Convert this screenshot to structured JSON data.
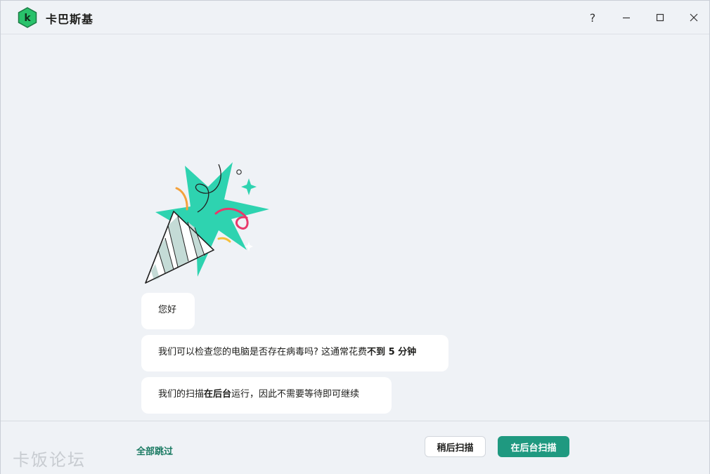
{
  "window": {
    "title": "卡巴斯基",
    "help_glyph": "?",
    "minimize_glyph": "—",
    "maximize_glyph": "☐",
    "close_glyph": "✕"
  },
  "messages": {
    "greeting": "您好",
    "scan_question_pre": "我们可以检查您的电脑是否存在病毒吗? 这通常花费",
    "scan_question_bold": "不到 5 分钟",
    "background_pre": "我们的扫描",
    "background_bold": "在后台",
    "background_post": "运行，因此不需要等待即可继续"
  },
  "footer": {
    "skip_all": "全部跳过",
    "scan_later": "稍后扫描",
    "scan_background": "在后台扫描"
  },
  "watermark": "卡饭论坛",
  "colors": {
    "accent": "#1f9980",
    "logo_green": "#2ac56b",
    "confetti_teal": "#2ed3b0",
    "confetti_pink": "#e8396b",
    "confetti_orange": "#f4a23c"
  }
}
